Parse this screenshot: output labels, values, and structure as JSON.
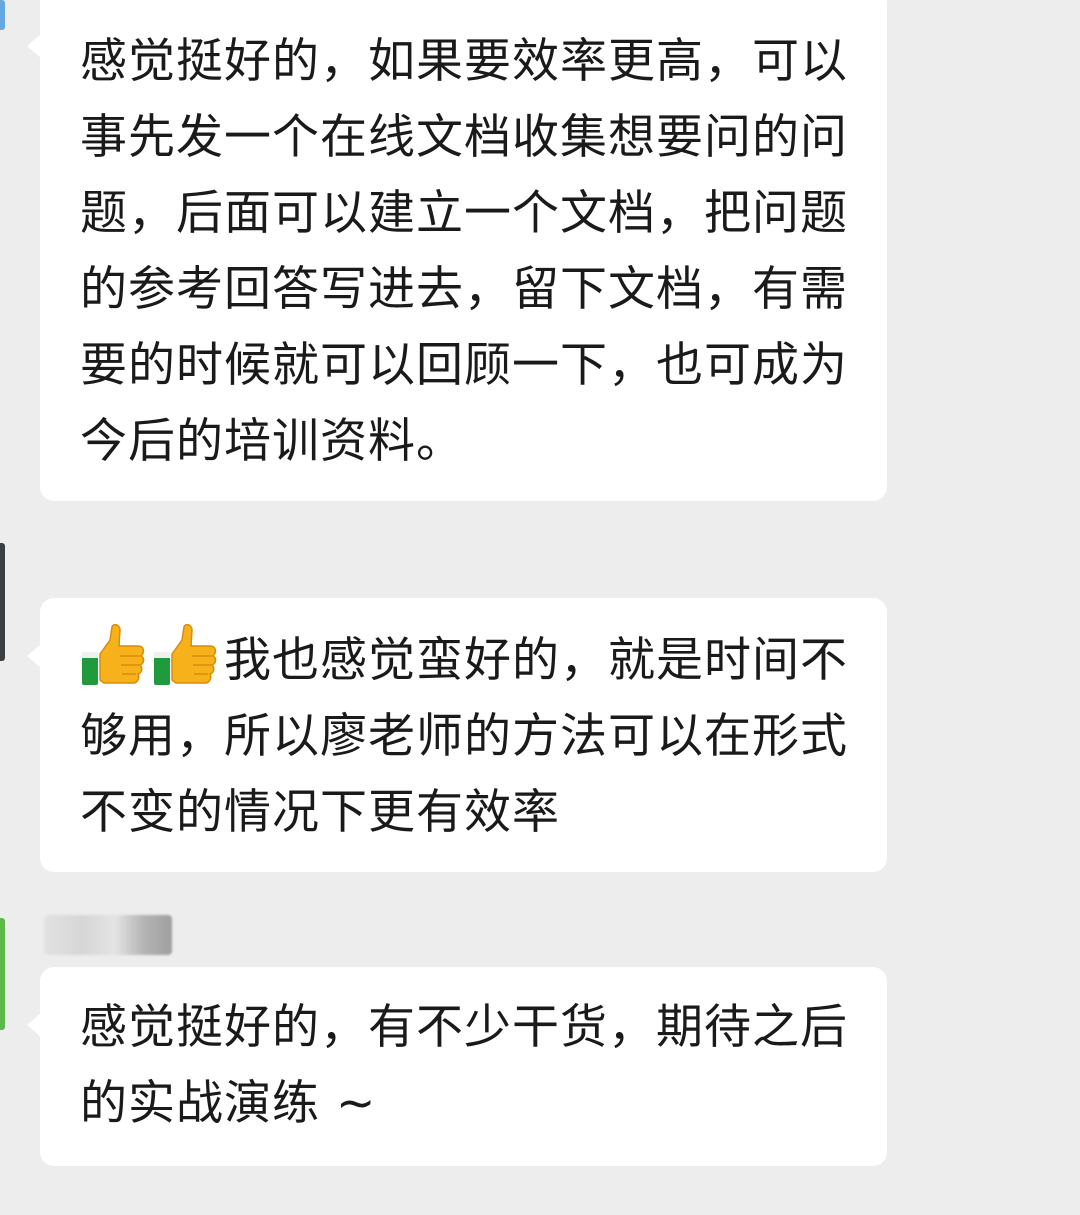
{
  "chat": {
    "messages": [
      {
        "text": "感觉挺好的，如果要效率更高，可以事先发一个在线文档收集想要问的问题，后面可以建立一个文档，把问题的参考回答写进去，留下文档，有需要的时候就可以回顾一下，也可成为今后的培训资料。"
      },
      {
        "emoji": [
          "thumbs-up-icon",
          "thumbs-up-icon"
        ],
        "text": "我也感觉蛮好的，就是时间不够用，所以廖老师的方法可以在形式不变的情况下更有效率"
      },
      {
        "text": "感觉挺好的，有不少干货，期待之后的实战演练 ~"
      }
    ]
  },
  "colors": {
    "background": "#ededed",
    "bubble": "#ffffff",
    "text": "#1a1a1a"
  }
}
